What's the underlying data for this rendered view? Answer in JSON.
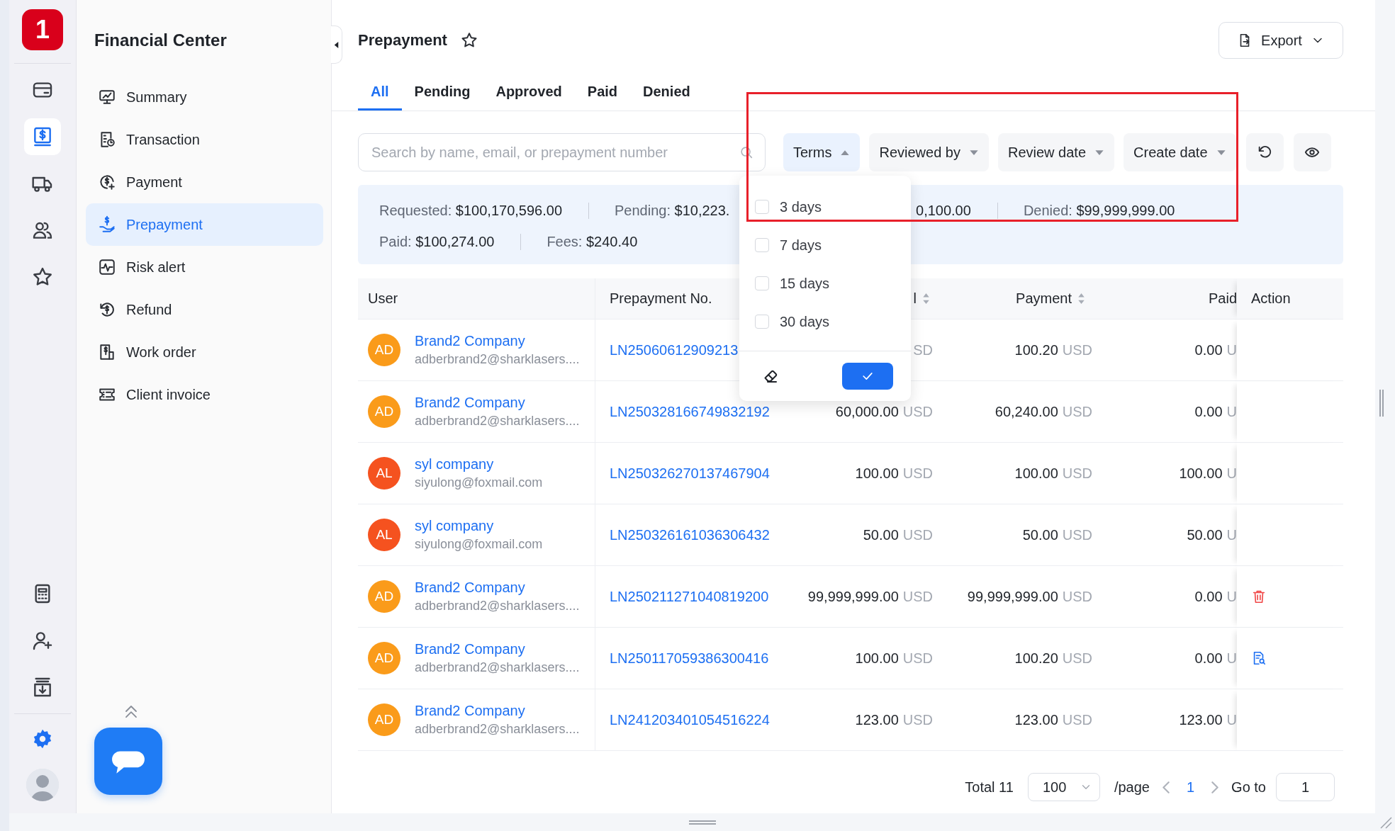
{
  "rail": {
    "logo": "1",
    "top": [
      {
        "selected": false
      },
      {
        "selected": true
      },
      {
        "selected": false
      },
      {
        "selected": false
      },
      {
        "selected": false
      }
    ],
    "bottom": [
      {
        "selected": false
      },
      {
        "selected": false
      },
      {
        "selected": false
      },
      {
        "selected": false
      }
    ]
  },
  "sidebar": {
    "title": "Financial Center",
    "items": [
      {
        "label": "Summary",
        "selected": false
      },
      {
        "label": "Transaction",
        "selected": false
      },
      {
        "label": "Payment",
        "selected": false
      },
      {
        "label": "Prepayment",
        "selected": true
      },
      {
        "label": "Risk alert",
        "selected": false
      },
      {
        "label": "Refund",
        "selected": false
      },
      {
        "label": "Work order",
        "selected": false
      },
      {
        "label": "Client invoice",
        "selected": false
      }
    ]
  },
  "page": {
    "title": "Prepayment",
    "favorite": false,
    "export": "Export"
  },
  "tabs": [
    {
      "label": "All",
      "selected": true
    },
    {
      "label": "Pending",
      "selected": false
    },
    {
      "label": "Approved",
      "selected": false
    },
    {
      "label": "Paid",
      "selected": false
    },
    {
      "label": "Denied",
      "selected": false
    }
  ],
  "search": {
    "placeholder": "Search by name, email, or prepayment number"
  },
  "filters": [
    {
      "label": "Terms",
      "open": true
    },
    {
      "label": "Reviewed by",
      "open": false
    },
    {
      "label": "Review date",
      "open": false
    },
    {
      "label": "Create date",
      "open": false
    }
  ],
  "summary": [
    [
      {
        "label": "Requested:",
        "value": "$100,170,596.00"
      },
      {
        "label": "Pending:",
        "value": "$10,223."
      },
      {
        "value": "0,100.00"
      },
      {
        "label": "Denied:",
        "value": "$99,999,999.00"
      }
    ],
    [
      {
        "label": "Paid:",
        "value": "$100,274.00"
      },
      {
        "label": "Fees:",
        "value": "$240.40"
      }
    ]
  ],
  "dropdown": {
    "options": [
      {
        "label": "3 days",
        "checked": false
      },
      {
        "label": "7 days",
        "checked": false
      },
      {
        "label": "15 days",
        "checked": false
      },
      {
        "label": "30 days",
        "checked": false
      }
    ]
  },
  "table": {
    "columns": [
      {
        "label": "User",
        "sortable": false
      },
      {
        "label": "Prepayment No.",
        "sortable": false
      },
      {
        "label": "l",
        "sortable": true
      },
      {
        "label": "Payment",
        "sortable": true
      },
      {
        "label": "Paid",
        "sortable": false
      },
      {
        "label": "Action",
        "sortable": false
      }
    ],
    "rows": [
      {
        "initials": "AD",
        "color": "#fa9b1a",
        "name": "Brand2 Company",
        "email": "adberbrand2@sharklasers....",
        "number": "LN25060612909213",
        "requested": {
          "unit": "SD"
        },
        "payment": {
          "amount": "100.20",
          "unit": "USD"
        },
        "paid": {
          "amount": "0.00",
          "unit": "U"
        }
      },
      {
        "initials": "AD",
        "color": "#fa9b1a",
        "name": "Brand2 Company",
        "email": "adberbrand2@sharklasers....",
        "number": "LN250328166749832192",
        "requested": {
          "amount": "60,000.00",
          "unit": "USD"
        },
        "payment": {
          "amount": "60,240.00",
          "unit": "USD"
        },
        "paid": {
          "amount": "0.00",
          "unit": "U"
        }
      },
      {
        "initials": "AL",
        "color": "#f5521f",
        "name": "syl company",
        "email": "siyulong@foxmail.com",
        "number": "LN250326270137467904",
        "requested": {
          "amount": "100.00",
          "unit": "USD"
        },
        "payment": {
          "amount": "100.00",
          "unit": "USD"
        },
        "paid": {
          "amount": "100.00",
          "unit": "U"
        }
      },
      {
        "initials": "AL",
        "color": "#f5521f",
        "name": "syl company",
        "email": "siyulong@foxmail.com",
        "number": "LN250326161036306432",
        "requested": {
          "amount": "50.00",
          "unit": "USD"
        },
        "payment": {
          "amount": "50.00",
          "unit": "USD"
        },
        "paid": {
          "amount": "50.00",
          "unit": "U"
        }
      },
      {
        "initials": "AD",
        "color": "#fa9b1a",
        "name": "Brand2 Company",
        "email": "adberbrand2@sharklasers....",
        "number": "LN250211271040819200",
        "requested": {
          "amount": "99,999,999.00",
          "unit": "USD"
        },
        "payment": {
          "amount": "99,999,999.00",
          "unit": "USD"
        },
        "paid": {
          "amount": "0.00",
          "unit": "U"
        },
        "action": {
          "kind": "delete"
        }
      },
      {
        "initials": "AD",
        "color": "#fa9b1a",
        "name": "Brand2 Company",
        "email": "adberbrand2@sharklasers....",
        "number": "LN250117059386300416",
        "requested": {
          "amount": "100.00",
          "unit": "USD"
        },
        "payment": {
          "amount": "100.20",
          "unit": "USD"
        },
        "paid": {
          "amount": "0.00",
          "unit": "U"
        },
        "action": {
          "kind": "review"
        }
      },
      {
        "initials": "AD",
        "color": "#fa9b1a",
        "name": "Brand2 Company",
        "email": "adberbrand2@sharklasers....",
        "number": "LN241203401054516224",
        "requested": {
          "amount": "123.00",
          "unit": "USD"
        },
        "payment": {
          "amount": "123.00",
          "unit": "USD"
        },
        "paid": {
          "amount": "123.00",
          "unit": "U"
        }
      }
    ]
  },
  "pagination": {
    "total": "Total 11",
    "page_size": "100",
    "per_page": "/page",
    "current": "1",
    "goto_label": "Go to",
    "goto_value": "1"
  },
  "annotations": [
    {
      "kind": "box"
    }
  ]
}
